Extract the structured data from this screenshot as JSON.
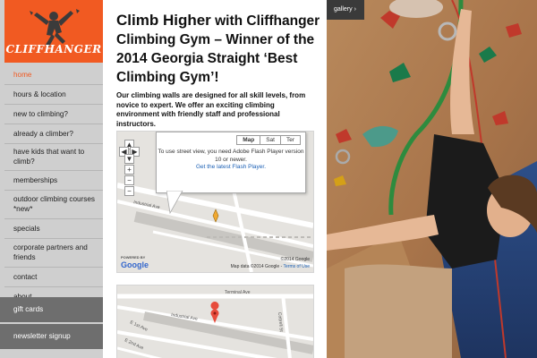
{
  "brand": {
    "name": "CLIFFHANGER",
    "accent": "#f15a22"
  },
  "nav": {
    "items": [
      {
        "label": "home",
        "active": true
      },
      {
        "label": "hours & location"
      },
      {
        "label": "new to climbing?"
      },
      {
        "label": "already a climber?"
      },
      {
        "label": "have kids that want to climb?"
      },
      {
        "label": "memberships"
      },
      {
        "label": "outdoor climbing courses *new*"
      },
      {
        "label": "specials"
      },
      {
        "label": "corporate partners and friends"
      },
      {
        "label": "contact"
      },
      {
        "label": "about"
      }
    ],
    "extras": [
      {
        "label": "gift cards"
      },
      {
        "label": "newsletter signup"
      }
    ]
  },
  "main": {
    "headline_lead": "Climb Higher",
    "headline_rest": " with Cliffhanger Climbing Gym – Winner of the 2014 Georgia Straight ‘Best Climbing Gym’!",
    "intro": "Our climbing walls are designed for all skill levels, from novice to expert. We offer an exciting climbing environment with friendly staff and professional instructors."
  },
  "map1": {
    "tabs": [
      "Map",
      "Sat",
      "Ter"
    ],
    "active_tab": "Map",
    "info_text": "To use street view, you need Adobe Flash Player version 10 or newer.",
    "info_link": "Get the latest Flash Player.",
    "street_label": "Industrial Ave",
    "powered_by": "POWERED BY",
    "google": "Google",
    "map_data": "Map data ©2014 Google",
    "terms": "Terms of Use",
    "copyright": "©2014 Google"
  },
  "map2": {
    "streets": [
      "Terminal Ave",
      "Industrial Ave",
      "E 1st Ave",
      "E 2nd Ave",
      "Cottrell St"
    ]
  },
  "gallery": {
    "label": "gallery"
  },
  "colors": {
    "sidebar": "#cfcfcf",
    "extra_button": "#6e6e6e",
    "link": "#1a5fb4"
  }
}
